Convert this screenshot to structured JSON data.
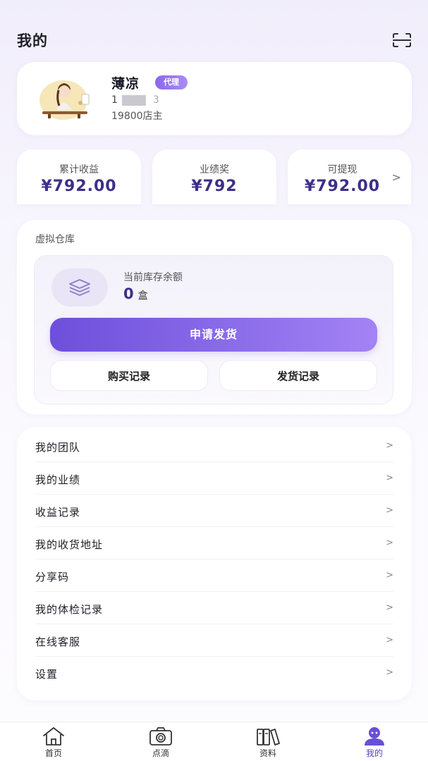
{
  "header": {
    "title": "我的",
    "scan_icon": "scan-icon"
  },
  "profile": {
    "name": "薄凉",
    "badge": "代理",
    "phone_prefix": "1",
    "phone_suffix": "3",
    "shop": "19800店主",
    "avatar_icon": "avatar-illustration"
  },
  "stats": [
    {
      "label": "累计收益",
      "value": "¥792.00"
    },
    {
      "label": "业绩奖",
      "value": "¥792"
    },
    {
      "label": "可提现",
      "value": "¥792.00",
      "arrow": ">"
    }
  ],
  "warehouse": {
    "title": "虚拟仓库",
    "stock_label": "当前库存余额",
    "stock_value": "0",
    "stock_unit": "盒",
    "stock_icon": "layers-icon",
    "ship_button": "申请发货",
    "purchase_records": "购买记录",
    "shipping_records": "发货记录"
  },
  "menu": [
    {
      "label": "我的团队",
      "arrow": ">"
    },
    {
      "label": "我的业绩",
      "arrow": ">"
    },
    {
      "label": "收益记录",
      "arrow": ">"
    },
    {
      "label": "我的收货地址",
      "arrow": ">"
    },
    {
      "label": "分享码",
      "arrow": ">"
    },
    {
      "label": "我的体检记录",
      "arrow": ">"
    },
    {
      "label": "在线客服",
      "arrow": ">"
    },
    {
      "label": "设置",
      "arrow": ">"
    }
  ],
  "tabbar": [
    {
      "label": "首页",
      "icon": "home-icon"
    },
    {
      "label": "点滴",
      "icon": "camera-icon"
    },
    {
      "label": "资料",
      "icon": "books-icon"
    },
    {
      "label": "我的",
      "icon": "profile-icon",
      "active": true
    }
  ],
  "colors": {
    "accent": "#7a5ae4",
    "value_text": "#3d2f8a"
  }
}
